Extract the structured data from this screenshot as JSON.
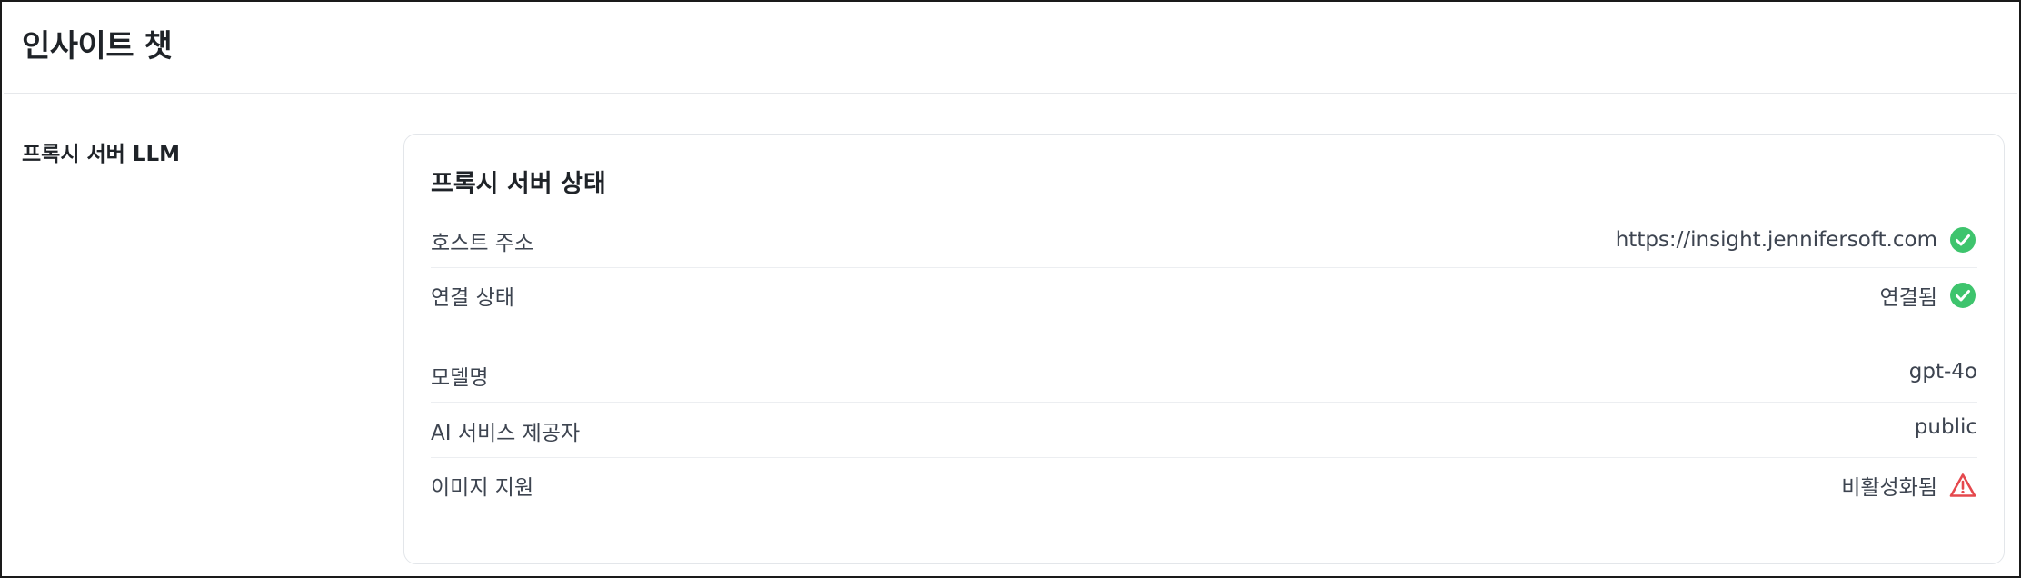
{
  "header": {
    "title": "인사이트 챗"
  },
  "section": {
    "label": "프록시 서버 LLM"
  },
  "card": {
    "title": "프록시 서버 상태",
    "rows": [
      {
        "label": "호스트 주소",
        "value": "https://insight.jennifersoft.com",
        "status_icon": "check-circle-icon"
      },
      {
        "label": "연결 상태",
        "value": "연결됨",
        "status_icon": "check-circle-icon"
      },
      {
        "label": "모델명",
        "value": "gpt-4o"
      },
      {
        "label": "AI 서비스 제공자",
        "value": "public"
      },
      {
        "label": "이미지 지원",
        "value": "비활성화됨",
        "status_icon": "warning-triangle-icon"
      }
    ]
  },
  "colors": {
    "success": "#3ec46d",
    "warning": "#e5484d",
    "text": "#1f2328",
    "muted_text": "#3d4450",
    "border": "#e3e6ea"
  }
}
